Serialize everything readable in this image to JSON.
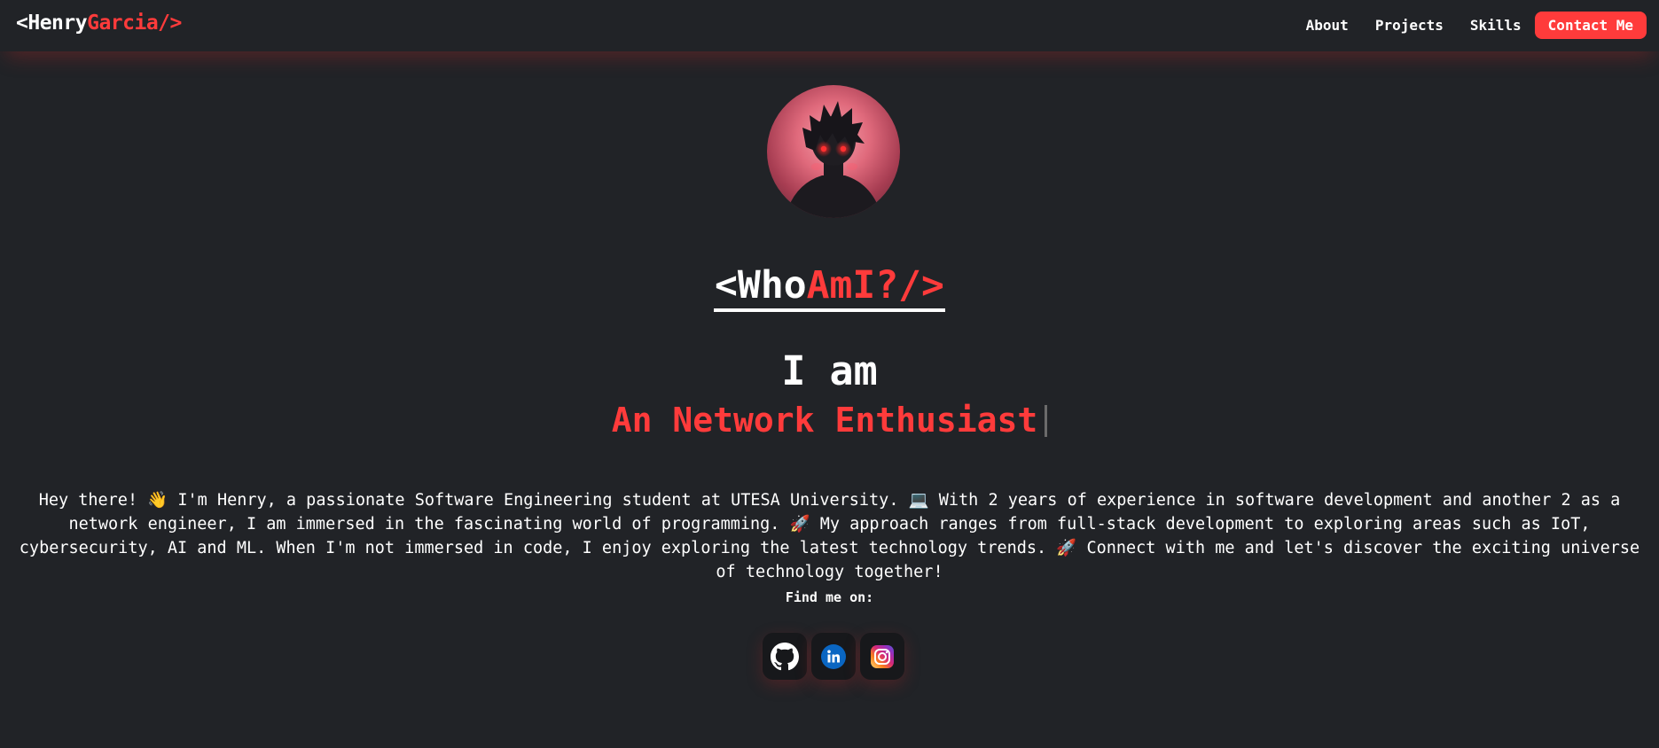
{
  "brand": {
    "prefix": "<Henry",
    "accent": "Garcia/>"
  },
  "nav": {
    "links": [
      "About",
      "Projects",
      "Skills"
    ],
    "cta": "Contact Me"
  },
  "hero": {
    "title_white": "<Who",
    "title_red": "AmI?/>",
    "intro": "I am",
    "role": "An Network Enthusiast"
  },
  "bio": {
    "text": "Hey there! 👋 I'm Henry, a passionate Software Engineering student at UTESA University. 💻 With 2 years of experience in software development and another 2 as a network engineer, I am immersed in the fascinating world of programming. 🚀 My approach ranges from full-stack development to exploring areas such as IoT, cybersecurity, AI and ML. When I'm not immersed in code, I enjoy exploring the latest technology trends. 🚀 Connect with me and let's discover the exciting universe of technology together!"
  },
  "socials": {
    "label": "Find me on:",
    "items": [
      {
        "name": "github",
        "icon": "github-icon"
      },
      {
        "name": "linkedin",
        "icon": "linkedin-icon"
      },
      {
        "name": "instagram",
        "icon": "instagram-icon"
      }
    ]
  },
  "colors": {
    "background": "#212327",
    "accent": "#ff3b3b",
    "text": "#ffffff"
  }
}
